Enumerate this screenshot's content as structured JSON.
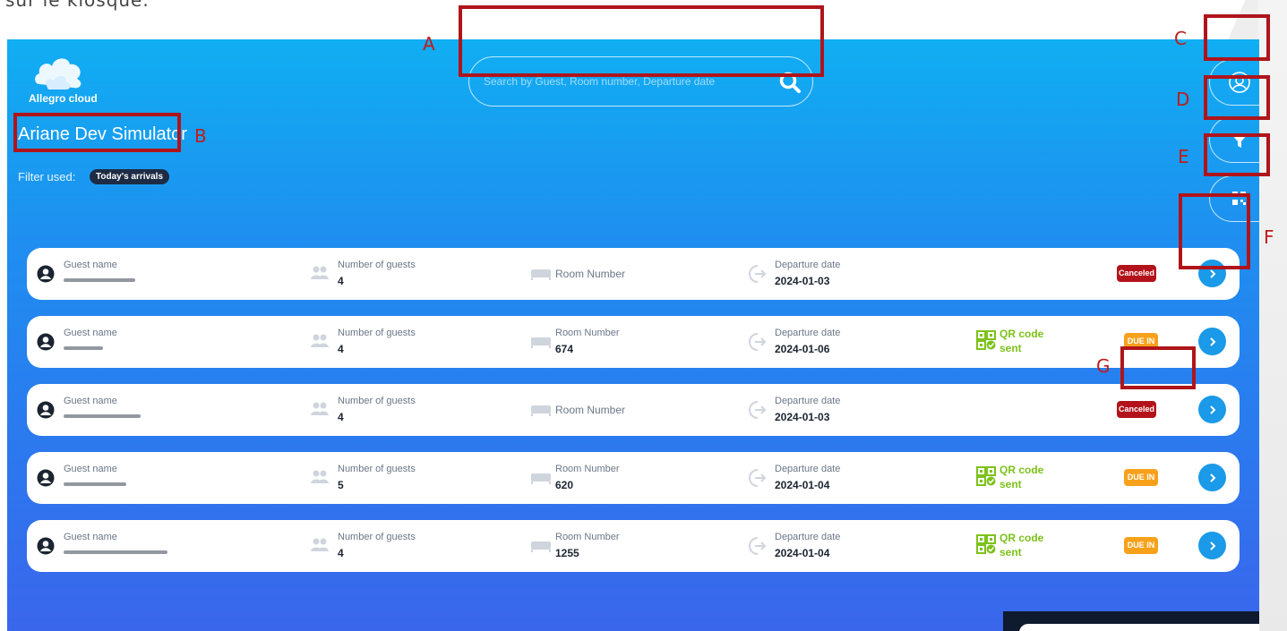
{
  "page": {
    "top_text": "sur le kiosque."
  },
  "app": {
    "logo_text": "Allegro cloud",
    "hotel_name": "Ariane Dev Simulator",
    "filter_label": "Filter used:",
    "filter_chip": "Today's arrivals"
  },
  "search": {
    "placeholder": "Search by Guest, Room number, Departure date",
    "icon": "search-icon"
  },
  "side_buttons": [
    "profile-icon",
    "filter-icon",
    "qr-icon"
  ],
  "columns": {
    "guest_name": "Guest name",
    "guests": "Number of guests",
    "room": "Room Number",
    "departure": "Departure date",
    "qr_code": "QR code",
    "qr_sent": "sent"
  },
  "rows": [
    {
      "guests": "4",
      "room": "",
      "departure": "2024-01-03",
      "qr": false,
      "status": "Canceled",
      "status_type": "canceled"
    },
    {
      "guests": "4",
      "room": "674",
      "departure": "2024-01-06",
      "qr": true,
      "status": "DUE IN",
      "status_type": "duein"
    },
    {
      "guests": "4",
      "room": "",
      "departure": "2024-01-03",
      "qr": false,
      "status": "Canceled",
      "status_type": "canceled"
    },
    {
      "guests": "5",
      "room": "620",
      "departure": "2024-01-04",
      "qr": true,
      "status": "DUE IN",
      "status_type": "duein"
    },
    {
      "guests": "4",
      "room": "1255",
      "departure": "2024-01-04",
      "qr": true,
      "status": "DUE IN",
      "status_type": "duein"
    }
  ],
  "annotations": {
    "A": "A",
    "B": "B",
    "C": "C",
    "D": "D",
    "E": "E",
    "F": "F",
    "G": "G"
  },
  "colors": {
    "accent_blue": "#1a9ae8",
    "canceled": "#b3121b",
    "due_in": "#f7a11a",
    "qr_green": "#7cc21b",
    "annotation_red": "#b0141b"
  }
}
